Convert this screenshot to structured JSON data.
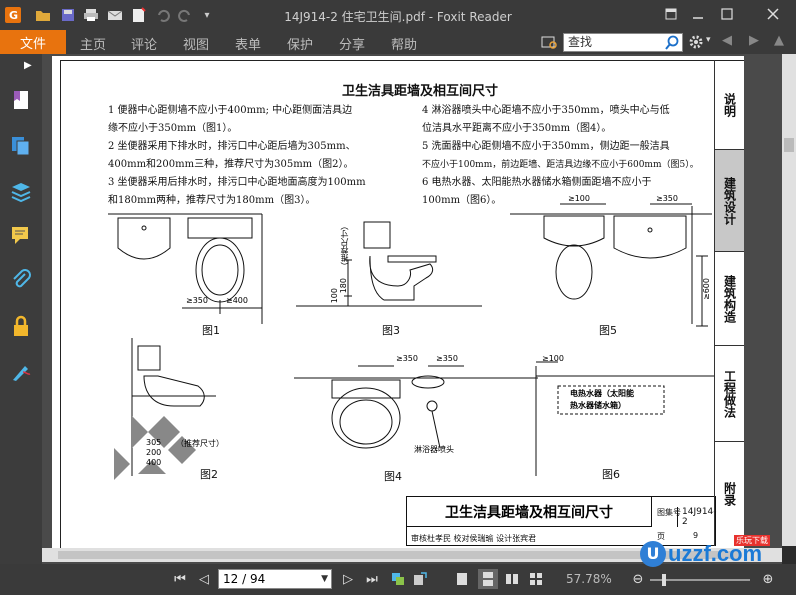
{
  "window": {
    "title": "14J914-2 住宅卫生间.pdf - Foxit Reader"
  },
  "menu": {
    "file": "文件",
    "items": [
      "主页",
      "评论",
      "视图",
      "表单",
      "保护",
      "分享",
      "帮助"
    ],
    "search_placeholder": "查找"
  },
  "document": {
    "title": "卫生洁具距墙及相互间尺寸",
    "left_paragraphs": [
      "1  便器中心距侧墙不应小于400mm; 中心距侧面洁具边",
      "缘不应小于350mm（图1）。",
      "2  坐便器采用下排水时，排污口中心距后墙为305mm、",
      "400mm和200mm三种，推荐尺寸为305mm（图2）。",
      "3  坐便器采用后排水时，排污口中心距地面高度为100mm",
      "和180mm两种，推荐尺寸为180mm（图3）。"
    ],
    "right_paragraphs": [
      "4  淋浴器喷头中心距墙不应小于350mm，喷头中心与低",
      "位洁具水平距离不应小于350mm（图4）。",
      "5  洗面器中心距侧墙不应小于350mm，侧边距一般洁具",
      "不应小于100mm，前边距墙、距洁具边缘不应小于600mm（图5）。",
      "6  电热水器、太阳能热水器储水箱侧面距墙不应小于",
      "100mm（图6）。"
    ],
    "figures": {
      "fig1": "图1",
      "fig2": "图2",
      "fig3": "图3",
      "fig4": "图4",
      "fig5": "图5",
      "fig6": "图6"
    },
    "dims": {
      "ge350": "≥350",
      "ge400": "≥400",
      "ge100": "≥100",
      "ge600": "≥600",
      "fig3_100": "100",
      "fig3_180": "180",
      "fig3_note": "（推荐尺寸）",
      "fig2_305": "305",
      "fig2_note": "（推荐尺寸）",
      "fig2_200": "200",
      "fig2_400": "400",
      "shower_label": "淋浴器喷头",
      "heater_label_1": "电热水器（太阳能",
      "heater_label_2": "热水器储水箱）"
    },
    "titleblock": {
      "title": "卫生洁具距墙及相互间尺寸",
      "atlas_label": "图集号",
      "atlas_no": "14J914-2",
      "page_label": "页",
      "page_no": "9",
      "row": "审核杜孝民  校对侯瑞瑜  设计张宾君"
    },
    "right_tabs": [
      "说明",
      "建筑设计",
      "建筑构造",
      "工程做法",
      "附录"
    ]
  },
  "status": {
    "page_display": "12 / 94",
    "zoom": "57.78%"
  },
  "watermark": {
    "text": "uzzf.com",
    "subtext": "乐玩下载"
  },
  "colors": {
    "accent": "#e8730e",
    "chrome": "#3a3a3a"
  }
}
